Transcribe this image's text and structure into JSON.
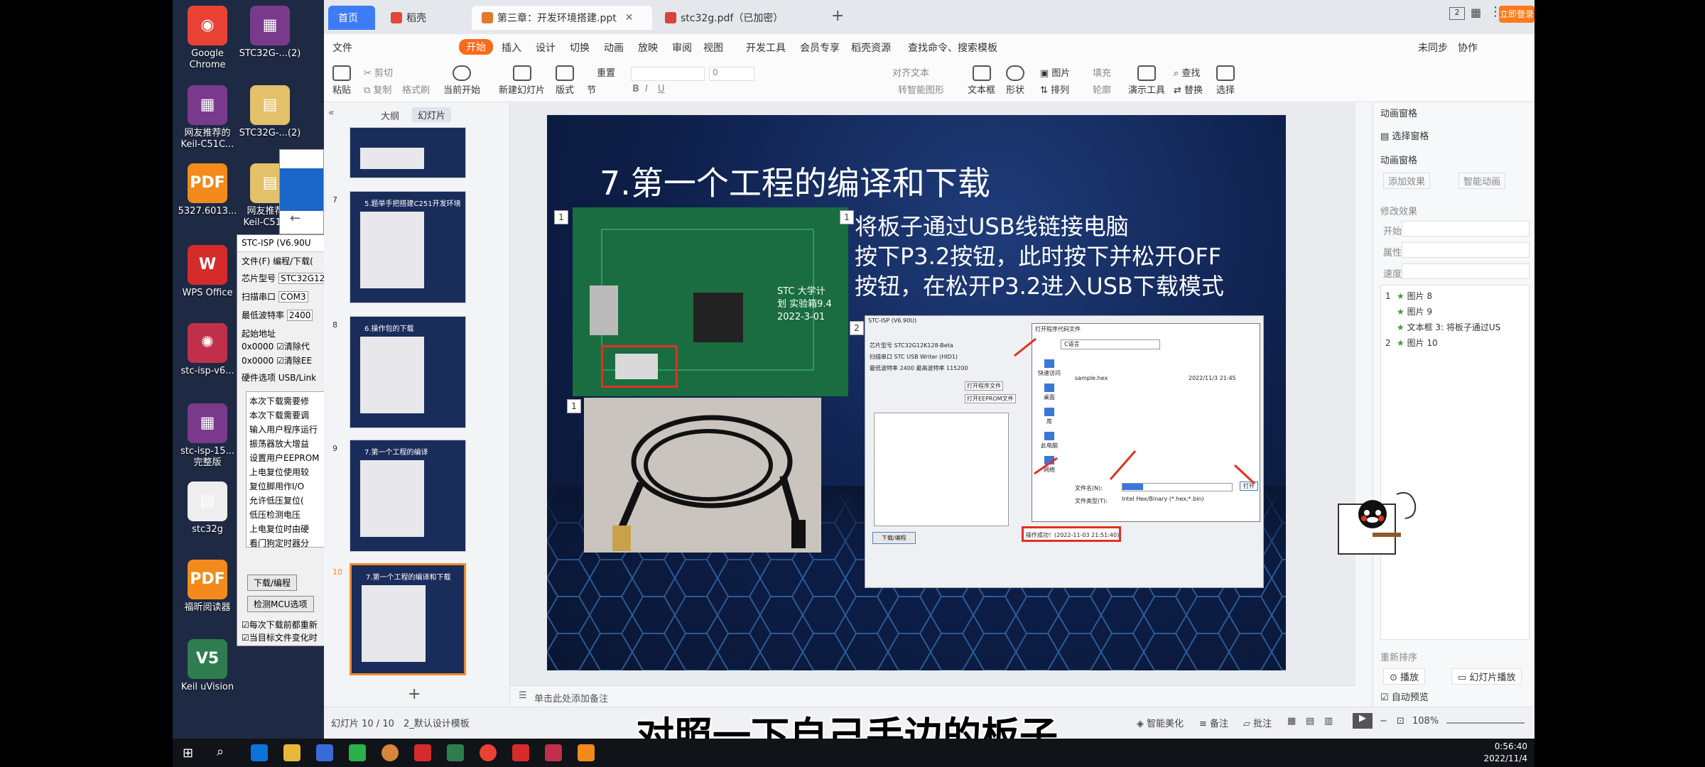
{
  "desktop": {
    "icons": [
      {
        "label": "Google Chrome",
        "color": "#e94235",
        "glyph": "◉"
      },
      {
        "label": "STC32G-...(2)",
        "color": "#7a3a8c",
        "glyph": "▦"
      },
      {
        "label": "网友推荐的 Keil-C51C...",
        "color": "#7a3a8c",
        "glyph": "▦"
      },
      {
        "label": "STC32G-...(2)",
        "color": "#e3c06a",
        "glyph": "▤"
      },
      {
        "label": "5327.6013...",
        "color": "#f28a1c",
        "glyph": "PDF"
      },
      {
        "label": "网友推荐的 Keil-C51C...",
        "color": "#e3c06a",
        "glyph": "▤"
      },
      {
        "label": "WPS Office",
        "color": "#d52b2b",
        "glyph": "W"
      },
      {
        "label": "stc-isp-v6...",
        "color": "#c0304a",
        "glyph": "✺"
      },
      {
        "label": "stc-isp-15... 完整版",
        "color": "#7a3a8c",
        "glyph": "▦"
      },
      {
        "label": "stc32g",
        "color": "#eeeeee",
        "glyph": "▤"
      },
      {
        "label": "福昕阅读器",
        "color": "#f28a1c",
        "glyph": "PDF"
      },
      {
        "label": "Keil uVision",
        "color": "#2e7d4f",
        "glyph": "V5"
      }
    ]
  },
  "stc_window": {
    "title": "STC-ISP (V6.90U",
    "menu": "文件(F)  编程/下载(",
    "chip_label": "芯片型号",
    "chip_value": "STC32G12",
    "port_label": "扫描串口",
    "port_value": "COM3",
    "baud_label": "最低波特率",
    "baud_value": "2400",
    "addr_label": "起始地址",
    "addr1": "0x0000",
    "addr2": "0x0000",
    "clear1": "清除代",
    "clear2": "清除EE",
    "hw_label": "硬件选项",
    "hw_value": "USB/Link",
    "options": [
      "本次下载需要修",
      "本次下载需要调",
      "输入用户程序运行",
      "振荡器放大增益",
      "设置用户EEPROM",
      "上电复位使用较",
      "复位脚用作I/O",
      "允许低压复位(",
      "低压检测电压",
      "上电复位时由硬",
      "看门狗定时器分"
    ],
    "download_btn": "下载/编程",
    "detect_btn": "检测MCU选项",
    "check1": "每次下载前都重新",
    "check2": "当目标文件变化时"
  },
  "tabs": [
    {
      "label": "首页",
      "active": false,
      "accent": "#3d7bf7"
    },
    {
      "label": "稻壳",
      "active": false,
      "accent": "#e0483a"
    },
    {
      "label": "第三章：开发环境搭建.ppt",
      "active": true,
      "accent": "#e07a2e"
    },
    {
      "label": "stc32g.pdf（已加密）",
      "active": false,
      "accent": "#d8443b"
    }
  ],
  "window_controls": {
    "login": "立即登录",
    "badge": "2"
  },
  "menus": [
    "文件",
    "开始",
    "插入",
    "设计",
    "切换",
    "动画",
    "放映",
    "审阅",
    "视图",
    "开发工具",
    "会员专享",
    "稻壳资源",
    "查找命令、搜索模板"
  ],
  "menu_right": [
    "未同步",
    "协作"
  ],
  "ribbon": {
    "paste": "粘贴",
    "cut": "剪切",
    "copy": "复制",
    "format_painter": "格式刷",
    "from_current": "当前开始",
    "new_slide": "新建幻灯片",
    "layout": "版式",
    "section": "节",
    "reset": "重置",
    "font_size": "0",
    "align_text": "对齐文本",
    "convert_smartart": "转智能图形",
    "textbox": "文本框",
    "shape": "形状",
    "picture": "图片",
    "arrange": "排列",
    "fill": "填充",
    "outline": "轮廓",
    "find": "查找",
    "replace": "替换",
    "presenter": "演示工具",
    "select": "选择"
  },
  "view_tabs": {
    "outline": "大纲",
    "slides": "幻灯片"
  },
  "thumbnails": [
    {
      "num": "",
      "title": ""
    },
    {
      "num": "7",
      "title": "5.题举手把搭建C251开发环境"
    },
    {
      "num": "8",
      "title": "6.操作包的下载"
    },
    {
      "num": "9",
      "title": "7.第一个工程的编译"
    },
    {
      "num": "10",
      "title": "7.第一个工程的编译和下载"
    }
  ],
  "slide": {
    "title": "7.第一个工程的编译和下载",
    "lines": [
      "将板子通过USB线链接电脑",
      "按下P3.2按钮，此时按下并松开OFF",
      "按钮，在松开P3.2进入USB下载模式"
    ],
    "badges": [
      "1",
      "1",
      "1",
      "2"
    ],
    "pcb_text": "STC 大学计划 实验箱9.4 2022-3-01",
    "isp": {
      "title": "STC-ISP (V6.90U)",
      "chip": "STC32G12K128-Beta",
      "port": "STC USB Writer (HID1)",
      "baud": "2400",
      "max_baud": "115200",
      "open_prog": "打开程序文件",
      "open_eeprom": "打开EEPROM文件",
      "dialog_title": "打开程序代码文件",
      "look_in": "C语言",
      "file": "sample.hex",
      "file_date": "2022/11/3 21:45",
      "file_name_label": "文件名(N):",
      "file_type_label": "文件类型(T):",
      "file_type": "Intel Hex/Binary (*.hex;*.bin)",
      "open_btn": "打开",
      "download_btn": "下载/编程",
      "status": "操作成功！(2022-11-03 21:51:40)",
      "sidebar": [
        "快速访问",
        "桌面",
        "库",
        "此电脑",
        "网络"
      ]
    }
  },
  "right_pane": {
    "title": "动画窗格",
    "select_pane": "选择窗格",
    "anim_pane": "动画窗格",
    "add_effect": "添加效果",
    "smart_anim": "智能动画",
    "modify": "修改效果",
    "start": "开始:",
    "property": "属性:",
    "speed": "速度:",
    "items": [
      {
        "step": "1",
        "label": "图片 8"
      },
      {
        "step": "",
        "label": "图片 9"
      },
      {
        "step": "",
        "label": "文本框 3: 将板子通过US"
      },
      {
        "step": "2",
        "label": "图片 10"
      }
    ],
    "reorder": "重新排序",
    "play": "播放",
    "slideshow": "幻灯片播放",
    "autopreview": "自动预览"
  },
  "notes": "单击此处添加备注",
  "status": {
    "slide_count": "幻灯片 10 / 10",
    "theme": "2_默认设计模板",
    "beautify": "智能美化",
    "notes_btn": "备注",
    "comment_btn": "批注",
    "zoom": "108%"
  },
  "subtitle": "对照一下自己手边的板子",
  "taskbar": {
    "time": "0:56:40",
    "date": "2022/11/4"
  }
}
